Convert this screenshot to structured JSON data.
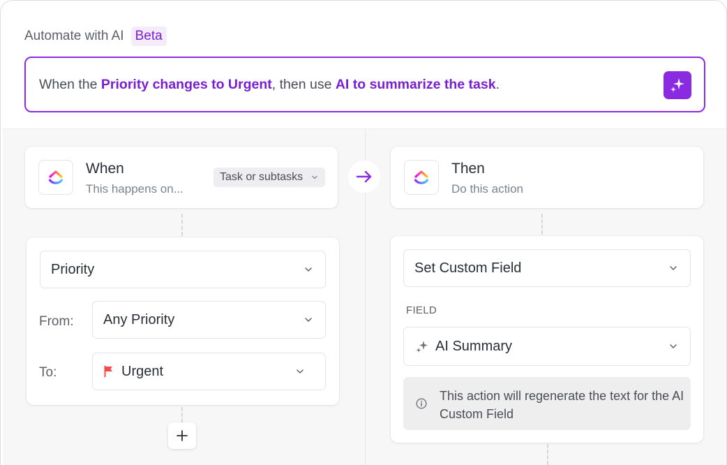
{
  "header": {
    "title": "Automate with AI",
    "badge": "Beta"
  },
  "prompt": {
    "part1": "When the ",
    "highlight1": "Priority changes to Urgent",
    "part2": ", then use ",
    "highlight2": "AI to summarize the task",
    "part3": "."
  },
  "trigger": {
    "title": "When",
    "subtitle": "This happens on...",
    "scope": "Task or subtasks",
    "field": "Priority",
    "from_label": "From:",
    "from_value": "Any Priority",
    "to_label": "To:",
    "to_value": "Urgent"
  },
  "action": {
    "title": "Then",
    "subtitle": "Do this action",
    "type": "Set Custom Field",
    "field_caption": "FIELD",
    "field_value": "AI Summary",
    "info": "This action will regenerate the text for the AI Custom Field"
  },
  "icons": {
    "ai": "sparkle-icon",
    "logo": "clickup-logo-icon",
    "arrow": "arrow-right-icon",
    "add": "plus-icon",
    "flag": "flag-icon",
    "info": "info-icon",
    "chevron": "chevron-down-icon"
  },
  "colors": {
    "accent": "#8a2be2",
    "accent_text": "#7a1fd0",
    "urgent_flag": "#f44a4a"
  }
}
